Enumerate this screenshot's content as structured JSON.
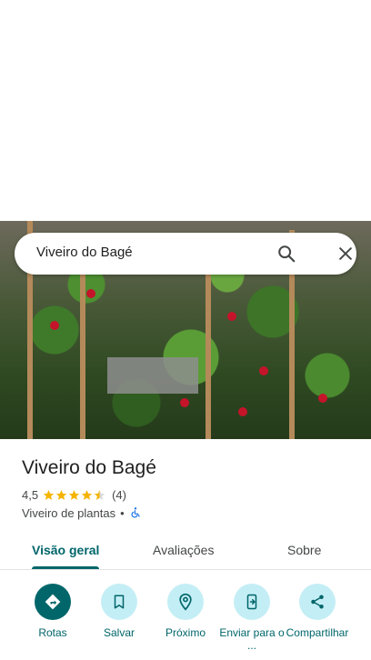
{
  "search": {
    "query": "Viveiro do Bagé",
    "icons": [
      "search-icon",
      "close-icon"
    ]
  },
  "place": {
    "title": "Viveiro do Bagé",
    "rating": "4,5",
    "rating_value": 4.5,
    "review_count": "(4)",
    "category": "Viveiro de plantas",
    "separator": "•",
    "accessibility_icon": "wheelchair-icon"
  },
  "tabs": [
    {
      "label": "Visão geral",
      "active": true
    },
    {
      "label": "Avaliações",
      "active": false
    },
    {
      "label": "Sobre",
      "active": false
    }
  ],
  "actions": [
    {
      "label": "Rotas",
      "icon": "directions-icon"
    },
    {
      "label": "Salvar",
      "icon": "bookmark-icon"
    },
    {
      "label": "Próximo",
      "icon": "nearby-icon"
    },
    {
      "label": "Enviar para o ...",
      "icon": "send-to-phone-icon"
    },
    {
      "label": "Compartilhar",
      "icon": "share-icon"
    }
  ],
  "colors": {
    "accent": "#00666a",
    "chip_bg": "#c4eef5",
    "star": "#f5b400"
  }
}
